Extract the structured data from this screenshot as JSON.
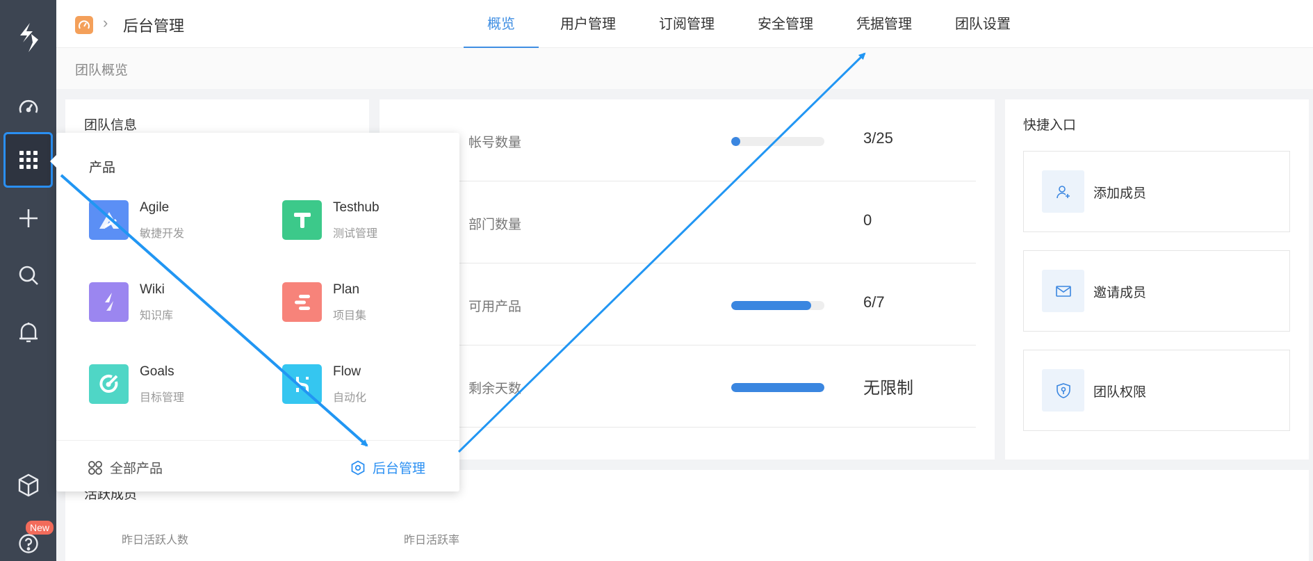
{
  "header": {
    "breadcrumb_title": "后台管理",
    "tabs": [
      {
        "label": "概览",
        "active": true
      },
      {
        "label": "用户管理",
        "active": false
      },
      {
        "label": "订阅管理",
        "active": false
      },
      {
        "label": "安全管理",
        "active": false
      },
      {
        "label": "凭据管理",
        "active": false
      },
      {
        "label": "团队设置",
        "active": false
      }
    ]
  },
  "page": {
    "subtitle": "团队概览"
  },
  "team_info": {
    "title": "团队信息"
  },
  "stats": [
    {
      "label": "帐号数量",
      "value": "3/25",
      "progress": 0.1
    },
    {
      "label": "部门数量",
      "value": "0",
      "progress": null
    },
    {
      "label": "可用产品",
      "value": "6/7",
      "progress": 0.86
    },
    {
      "label": "剩余天数",
      "value": "无限制",
      "progress": 1.0
    }
  ],
  "quick_links": {
    "title": "快捷入口",
    "items": [
      {
        "label": "添加成员",
        "icon": "add-user-icon"
      },
      {
        "label": "邀请成员",
        "icon": "mail-icon"
      },
      {
        "label": "团队权限",
        "icon": "shield-key-icon"
      }
    ]
  },
  "activity": {
    "title": "活跃成员",
    "metrics": [
      "昨日活跃人数",
      "昨日活跃率"
    ]
  },
  "product_menu": {
    "heading": "产品",
    "products": [
      {
        "name": "Agile",
        "desc": "敏捷开发",
        "color": "#5b8ff5",
        "icon": "agile-icon"
      },
      {
        "name": "Testhub",
        "desc": "测试管理",
        "color": "#3cc98a",
        "icon": "testhub-icon"
      },
      {
        "name": "Wiki",
        "desc": "知识库",
        "color": "#9b86f0",
        "icon": "wiki-icon"
      },
      {
        "name": "Plan",
        "desc": "项目集",
        "color": "#f7837a",
        "icon": "plan-icon"
      },
      {
        "name": "Goals",
        "desc": "目标管理",
        "color": "#4fd6c6",
        "icon": "goals-icon"
      },
      {
        "name": "Flow",
        "desc": "自动化",
        "color": "#35c6f0",
        "icon": "flow-icon"
      }
    ],
    "all_products_label": "全部产品",
    "admin_label": "后台管理"
  },
  "sidebar": {
    "new_badge": "New"
  },
  "colors": {
    "accent": "#2a8ff2",
    "rail": "#3d4552",
    "progress": "#3a86e0"
  }
}
